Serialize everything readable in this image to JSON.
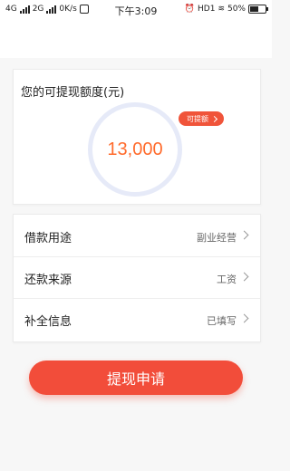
{
  "status_bar": {
    "network_left": "4G",
    "network_mid": "2G",
    "speed": "0K/s",
    "time": "下午3:09",
    "hd": "HD1",
    "battery": "50%"
  },
  "quota_card": {
    "title": "您的可提现额度(元)",
    "amount": "13,000",
    "badge_label": "可提额",
    "ring_color": "#e6eaf8",
    "amount_color": "#ff6b2c"
  },
  "info_rows": [
    {
      "label": "借款用途",
      "value": "副业经营"
    },
    {
      "label": "还款来源",
      "value": "工资"
    },
    {
      "label": "补全信息",
      "value": "已填写"
    }
  ],
  "submit": {
    "label": "提现申请",
    "color": "#f24d3a"
  }
}
